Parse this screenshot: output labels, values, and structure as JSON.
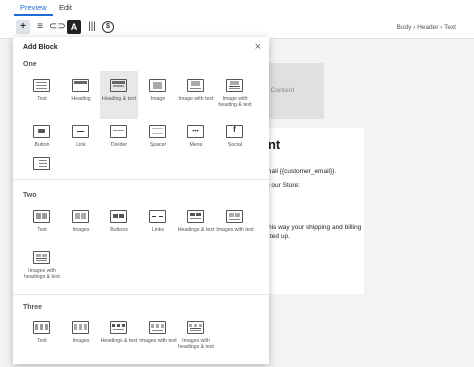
{
  "tabs": {
    "preview": "Preview",
    "edit": "Edit"
  },
  "breadcrumb": "Body › Header › Text",
  "canvas": {
    "dynamic_content": "mic Content",
    "heading": "unt",
    "line1": "e email {{customer_email}}.",
    "line2": "o our Store:",
    "line3": "his way your shipping and billing",
    "line4": "ted up."
  },
  "panel": {
    "title": "Add Block",
    "sections": {
      "one": {
        "title": "One",
        "items": [
          "Text",
          "Heading",
          "Heading & text",
          "Image",
          "Image with text",
          "Image with heading & text",
          "Button",
          "Link",
          "Divider",
          "Spacer",
          "Menu",
          "Social",
          ""
        ]
      },
      "two": {
        "title": "Two",
        "items": [
          "Text",
          "Images",
          "Buttons",
          "Links",
          "Headings & text",
          "Images with text",
          "Images with headings & text"
        ]
      },
      "three": {
        "title": "Three",
        "items": [
          "Text",
          "Images",
          "Headings & text",
          "Images with text",
          "Images with headings & text"
        ]
      }
    }
  }
}
